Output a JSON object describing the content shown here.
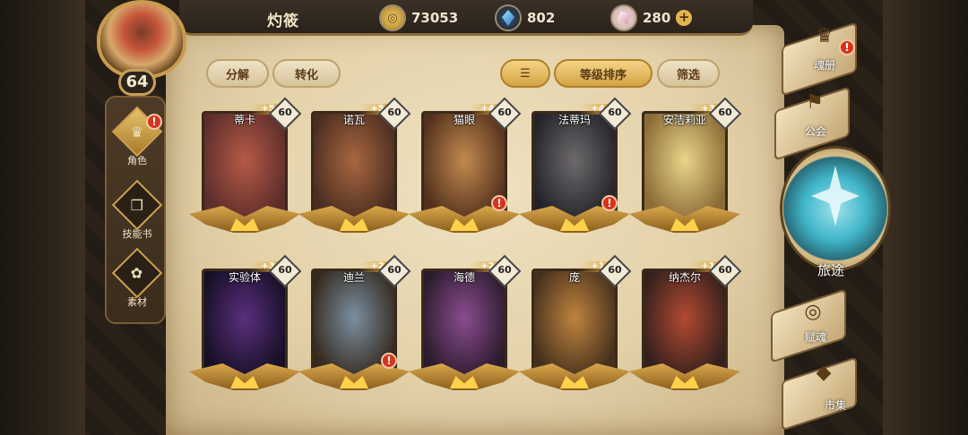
{
  "header": {
    "player_name": "灼筱",
    "gold": "73053",
    "diamonds": "802",
    "crystals": "280"
  },
  "player": {
    "level": "64"
  },
  "side_nav": [
    {
      "label": "角色"
    },
    {
      "label": "技能书"
    },
    {
      "label": "素材"
    }
  ],
  "toolbar": {
    "decompose": "分解",
    "convert": "转化",
    "sort_label": "等级排序",
    "filter": "筛选"
  },
  "cards": [
    {
      "name": "蒂卡",
      "stars": "+5",
      "level": "60",
      "alert": false,
      "c1": "#b65a46",
      "c2": "#5c2d2b"
    },
    {
      "name": "诺瓦",
      "stars": "+5",
      "level": "60",
      "alert": false,
      "c1": "#a8673f",
      "c2": "#4a2d20"
    },
    {
      "name": "猫眼",
      "stars": "+4",
      "level": "60",
      "alert": true,
      "c1": "#c28a4f",
      "c2": "#53301c"
    },
    {
      "name": "法蒂玛",
      "stars": "+4",
      "level": "60",
      "alert": true,
      "c1": "#6d6a6d",
      "c2": "#242327"
    },
    {
      "name": "安洁莉亚",
      "stars": "+3",
      "level": "60",
      "alert": false,
      "c1": "#e8d58a",
      "c2": "#8b6b35"
    },
    {
      "name": "实验体",
      "stars": "+3",
      "level": "60",
      "alert": false,
      "c1": "#5a2f7d",
      "c2": "#160f25"
    },
    {
      "name": "迪兰",
      "stars": "+2",
      "level": "60",
      "alert": true,
      "c1": "#7a8fa0",
      "c2": "#352a1f"
    },
    {
      "name": "海德",
      "stars": "+2",
      "level": "60",
      "alert": false,
      "c1": "#8a4c8f",
      "c2": "#2b1b2c"
    },
    {
      "name": "庞",
      "stars": "+1",
      "level": "60",
      "alert": false,
      "c1": "#bf843f",
      "c2": "#45301c"
    },
    {
      "name": "纳杰尔",
      "stars": "+1",
      "level": "60",
      "alert": false,
      "c1": "#b24a32",
      "c2": "#33201c"
    }
  ],
  "right_nav": {
    "soul_book": "魂册",
    "guild": "公会",
    "journey": "旅途",
    "soul_bind": "赋魂",
    "market": "市集"
  },
  "icons": [
    "coin-icon",
    "diamond-icon",
    "crystal-icon",
    "sort-icon",
    "role-icon",
    "skill-book-icon",
    "material-icon",
    "guild-icon",
    "soul-icon",
    "market-icon",
    "alert-icon"
  ]
}
